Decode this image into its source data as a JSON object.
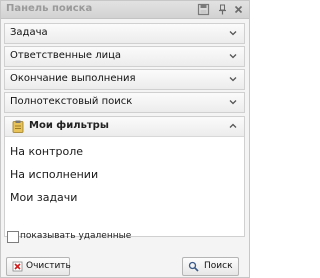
{
  "panel": {
    "title": "Панель поиска",
    "sections": [
      {
        "label": "Задача"
      },
      {
        "label": "Ответственные лица"
      },
      {
        "label": "Окончание выполнения"
      },
      {
        "label": "Полнотекстовый поиск"
      }
    ],
    "filters": {
      "header": "Мои фильтры",
      "items": [
        "На контроле",
        "На исполнении",
        "Мои задачи"
      ]
    },
    "show_deleted_label": "показывать удаленные",
    "show_deleted_checked": false,
    "clear_button": "Очистить",
    "search_button": "Поиск"
  }
}
